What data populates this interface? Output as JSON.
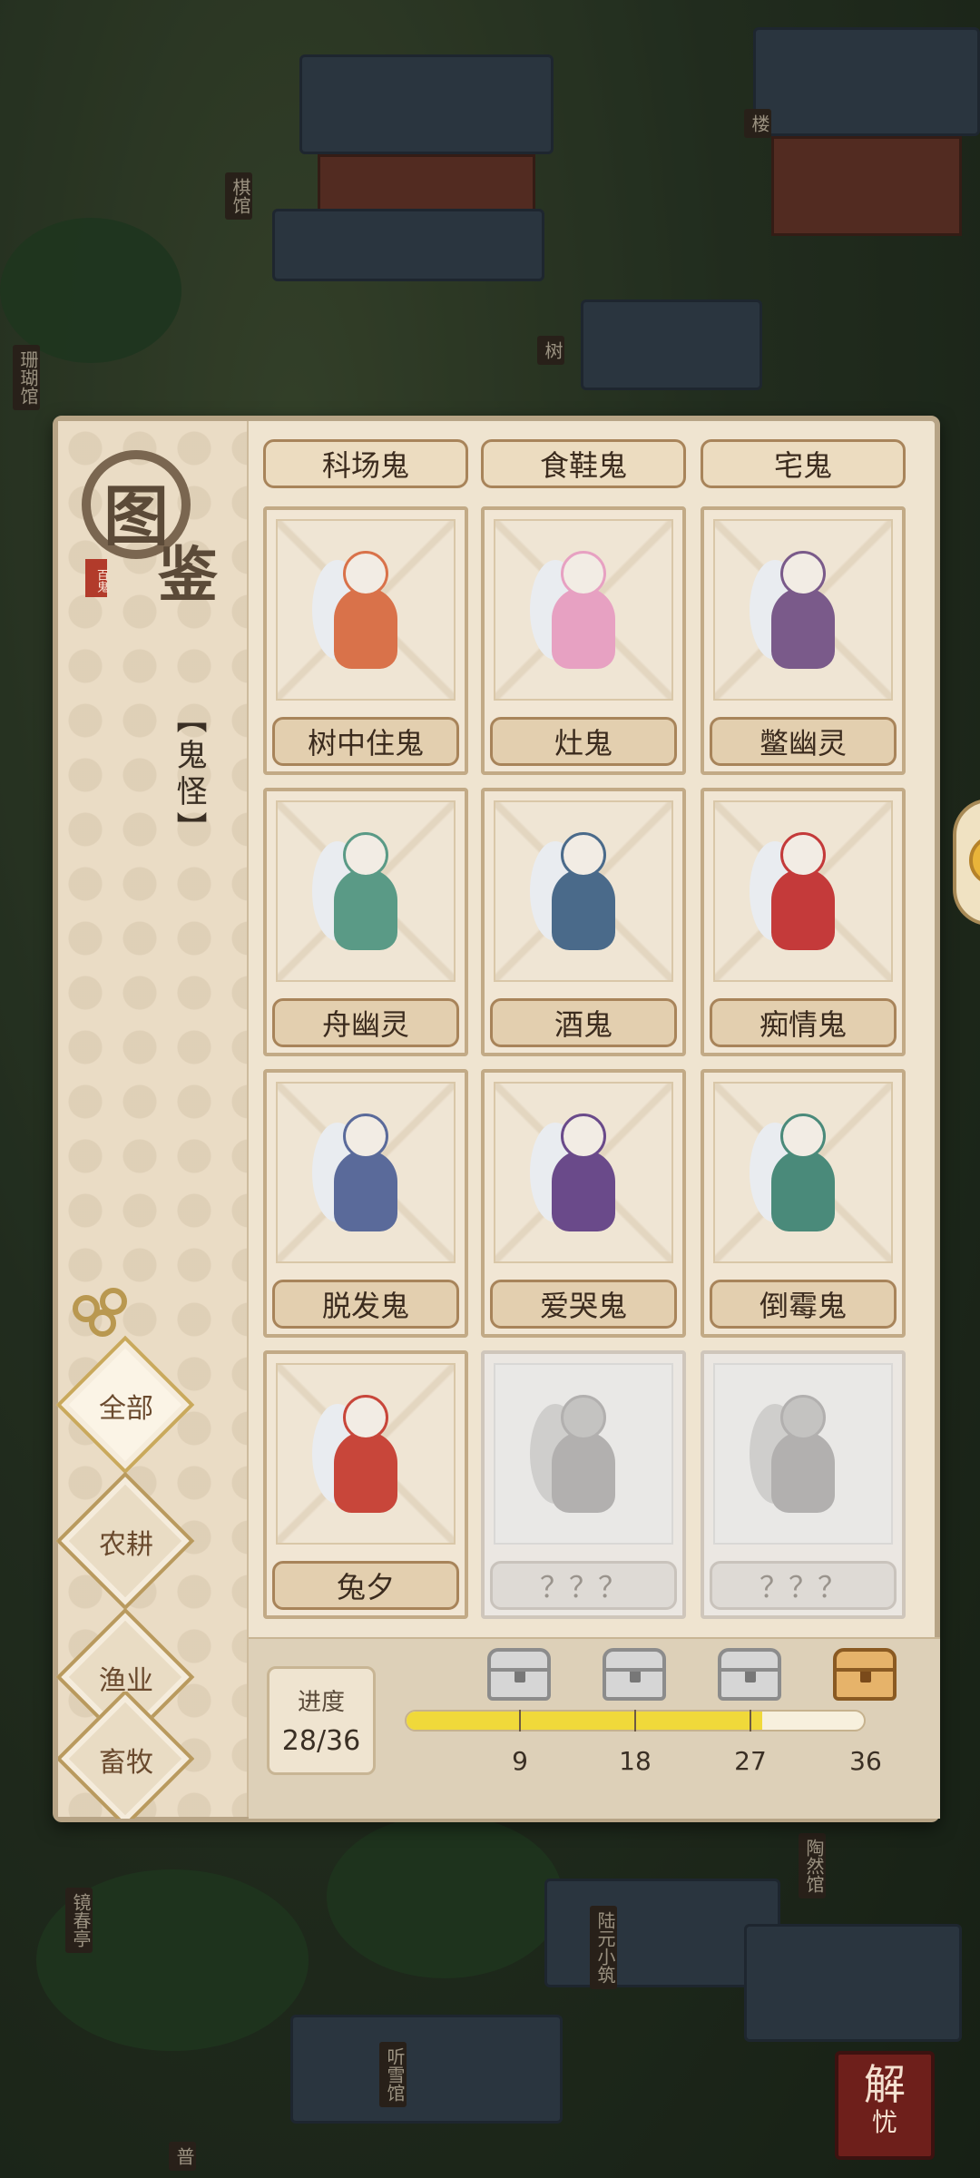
{
  "background": {
    "signs": [
      "棋馆",
      "楼",
      "珊瑚馆",
      "树",
      "镜春亭",
      "陆元小筑",
      "陶然馆",
      "听雪馆",
      "普"
    ]
  },
  "side_panel": {
    "title_char_1": "图",
    "title_char_2": "鉴",
    "seal_text": "百鬼",
    "category_label": "【鬼怪】",
    "tabs": [
      {
        "label": "全部",
        "active": true
      },
      {
        "label": "农耕",
        "active": false
      },
      {
        "label": "渔业",
        "active": false
      },
      {
        "label": "畜牧",
        "active": false
      }
    ]
  },
  "grid": {
    "top_row_labels": [
      "科场鬼",
      "食鞋鬼",
      "宅鬼"
    ],
    "cards": [
      {
        "name": "树中住鬼",
        "icon": "squirrel-ghost-icon",
        "locked": false,
        "color": "#d9724a"
      },
      {
        "name": "灶鬼",
        "icon": "stove-ghost-icon",
        "locked": false,
        "color": "#e7a1c2"
      },
      {
        "name": "鳖幽灵",
        "icon": "turtle-ghost-icon",
        "locked": false,
        "color": "#7a5a8a"
      },
      {
        "name": "舟幽灵",
        "icon": "boat-ghost-icon",
        "locked": false,
        "color": "#5a9a86"
      },
      {
        "name": "酒鬼",
        "icon": "drunk-ghost-icon",
        "locked": false,
        "color": "#4a6a8a"
      },
      {
        "name": "痴情鬼",
        "icon": "lovesick-ghost-icon",
        "locked": false,
        "color": "#c43a3a"
      },
      {
        "name": "脱发鬼",
        "icon": "bald-ghost-icon",
        "locked": false,
        "color": "#5a6a9a"
      },
      {
        "name": "爱哭鬼",
        "icon": "crying-ghost-icon",
        "locked": false,
        "color": "#6a4a8a"
      },
      {
        "name": "倒霉鬼",
        "icon": "unlucky-ghost-icon",
        "locked": false,
        "color": "#4a8a7a"
      },
      {
        "name": "兔夕",
        "icon": "rabbit-ghost-icon",
        "locked": false,
        "color": "#c8463a"
      },
      {
        "name": "？？？",
        "icon": "horn-ghost-silhouette-icon",
        "locked": true,
        "color": "#9a9a9a"
      },
      {
        "name": "？？？",
        "icon": "lion-mask-silhouette-icon",
        "locked": true,
        "color": "#9a9a9a"
      }
    ]
  },
  "progress": {
    "label": "进度",
    "value_text": "28/36",
    "current": 28,
    "total": 36,
    "milestones": [
      {
        "value": 9,
        "label": "9",
        "chest": "silver"
      },
      {
        "value": 18,
        "label": "18",
        "chest": "silver"
      },
      {
        "value": 27,
        "label": "27",
        "chest": "silver"
      },
      {
        "value": 36,
        "label": "36",
        "chest": "gold"
      }
    ],
    "fill_color": "#f0d93a"
  },
  "unlock_button": {
    "line1": "解",
    "line2": "忧"
  }
}
